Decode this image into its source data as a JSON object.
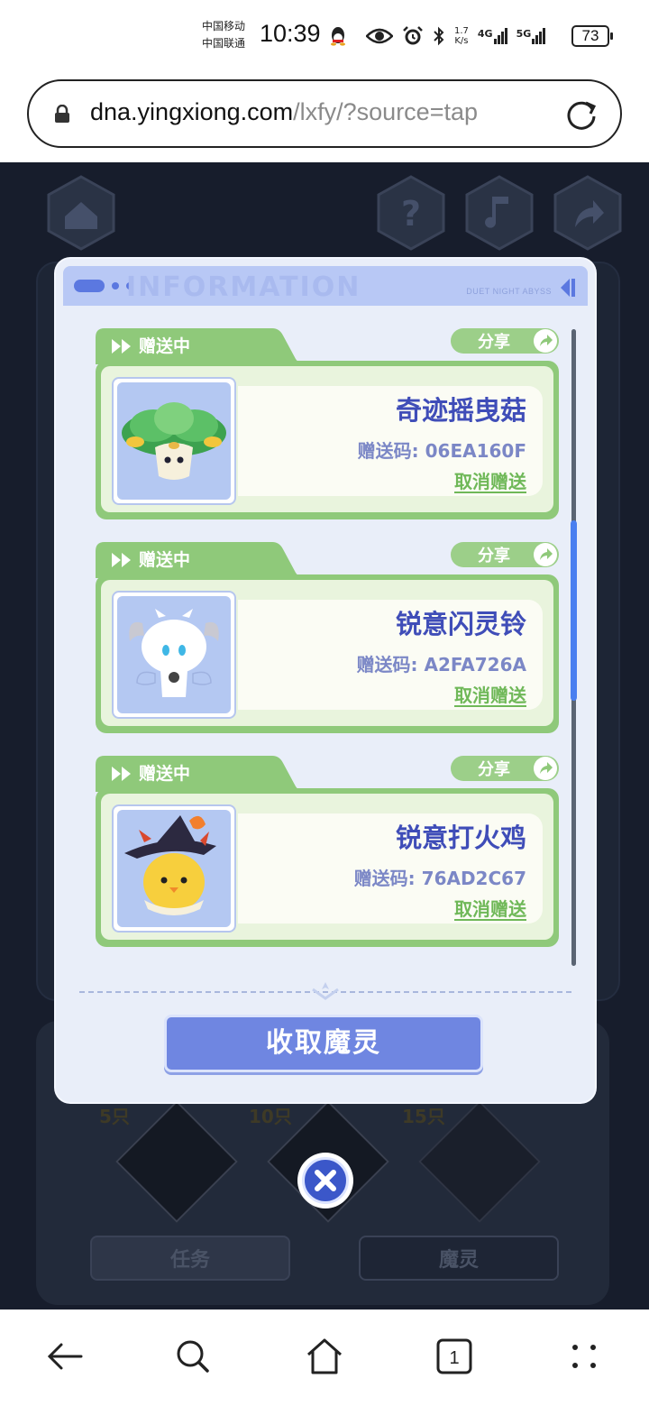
{
  "status_bar": {
    "carrier_1": "中国移动",
    "carrier_2": "中国联通",
    "time": "10:39",
    "net_speed_value": "1.7",
    "net_speed_unit": "K/s",
    "net_1": "4G",
    "net_2": "5G",
    "battery": "73"
  },
  "browser": {
    "url_host": "dna.yingxiong.com",
    "url_path": "/lxfy/?source=tap"
  },
  "modal": {
    "header_brand": "DUET NIGHT ABYSS",
    "header_ghost": "INFORMATION",
    "cards": [
      {
        "status_label": "赠送中",
        "share_label": "分享",
        "name": "奇迹摇曳菇",
        "code": "赠送码: 06EA160F",
        "cancel_label": "取消赠送"
      },
      {
        "status_label": "赠送中",
        "share_label": "分享",
        "name": "锐意闪灵铃",
        "code": "赠送码: A2FA726A",
        "cancel_label": "取消赠送"
      },
      {
        "status_label": "赠送中",
        "share_label": "分享",
        "name": "锐意打火鸡",
        "code": "赠送码: 76AD2C67",
        "cancel_label": "取消赠送"
      }
    ],
    "collect_button": "收取魔灵"
  },
  "background": {
    "tab_tasks": "任务",
    "tab_spirits": "魔灵",
    "milestones": [
      "5只",
      "10只",
      "15只"
    ]
  },
  "colors": {
    "accent_blue": "#3f4db8",
    "card_green": "#8fc97a",
    "button_blue": "#6f86e1"
  }
}
